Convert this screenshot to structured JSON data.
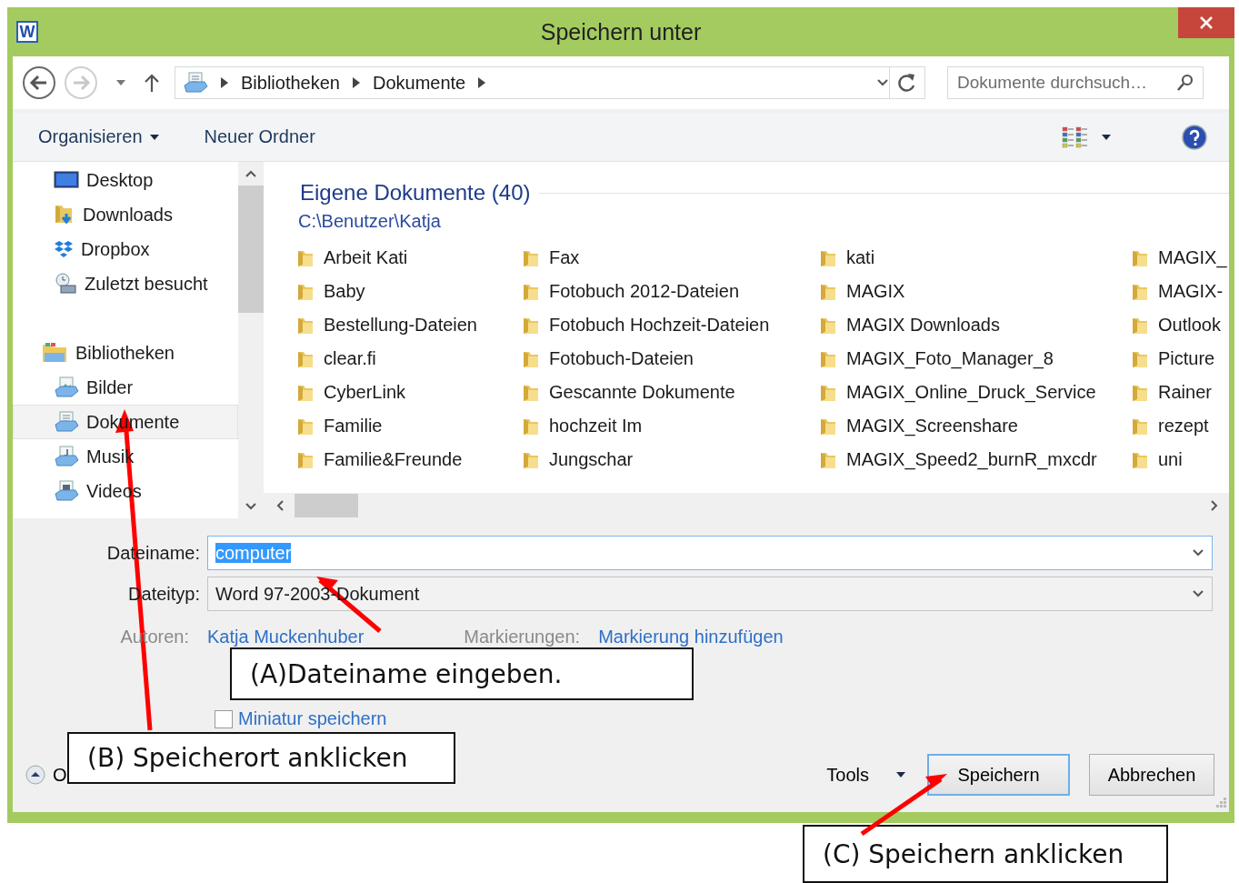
{
  "window": {
    "title": "Speichern unter",
    "app_icon_letter": "W"
  },
  "nav": {
    "breadcrumb": [
      "Bibliotheken",
      "Dokumente"
    ],
    "search": {
      "placeholder": "Dokumente durchsuch…"
    }
  },
  "toolbar": {
    "items": [
      {
        "label": "Organisieren",
        "dropdown": true
      },
      {
        "label": "Neuer Ordner",
        "dropdown": false
      }
    ]
  },
  "sidebar": {
    "items": [
      {
        "label": "Desktop",
        "kind": "desktop",
        "selected": false
      },
      {
        "label": "Downloads",
        "kind": "downloads",
        "selected": false
      },
      {
        "label": "Dropbox",
        "kind": "dropbox",
        "selected": false
      },
      {
        "label": "Zuletzt besucht",
        "kind": "recent",
        "selected": false
      },
      {
        "label": "Bibliotheken",
        "kind": "library",
        "selected": false,
        "children": [
          {
            "label": "Bilder",
            "kind": "pictures",
            "selected": false
          },
          {
            "label": "Dokumente",
            "kind": "documents",
            "selected": true
          },
          {
            "label": "Musik",
            "kind": "music",
            "selected": false
          },
          {
            "label": "Videos",
            "kind": "videos",
            "selected": false
          }
        ]
      }
    ]
  },
  "content": {
    "heading": "Eigene Dokumente (40)",
    "path": "C:\\Benutzer\\Katja",
    "folders": [
      "Arbeit Kati",
      "Baby",
      "Bestellung-Dateien",
      "clear.fi",
      "CyberLink",
      "Familie",
      "Familie&Freunde",
      "Fax",
      "Fotobuch 2012-Dateien",
      "Fotobuch Hochzeit-Dateien",
      "Fotobuch-Dateien",
      "Gescannte Dokumente",
      "hochzeit Im",
      "Jungschar",
      "kati",
      "MAGIX",
      "MAGIX Downloads",
      "MAGIX_Foto_Manager_8",
      "MAGIX_Online_Druck_Service",
      "MAGIX_Screenshare",
      "MAGIX_Speed2_burnR_mxcdr",
      "MAGIX_",
      "MAGIX-",
      "Outlook",
      "Picture",
      "Rainer",
      "rezept",
      "uni"
    ]
  },
  "form": {
    "filename": {
      "label": "Dateiname:",
      "value": "computer",
      "selected": true
    },
    "filetype": {
      "label": "Dateityp:",
      "value": "Word 97-2003-Dokument"
    },
    "authors": {
      "label": "Autoren:",
      "value": "Katja Muckenhuber"
    },
    "tags": {
      "label": "Markierungen:",
      "value": "Markierung hinzufügen"
    },
    "thumbnail": {
      "label": "Miniatur speichern",
      "checked": false
    }
  },
  "footer": {
    "hide_folders": "O",
    "tools": "Tools",
    "buttons": [
      {
        "label": "Speichern",
        "default": true
      },
      {
        "label": "Abbrechen",
        "default": false
      }
    ]
  },
  "annotations": [
    {
      "label": "(A)Dateiname eingeben."
    },
    {
      "label": "(B) Speicherort anklicken"
    },
    {
      "label": "(C) Speichern anklicken"
    }
  ]
}
